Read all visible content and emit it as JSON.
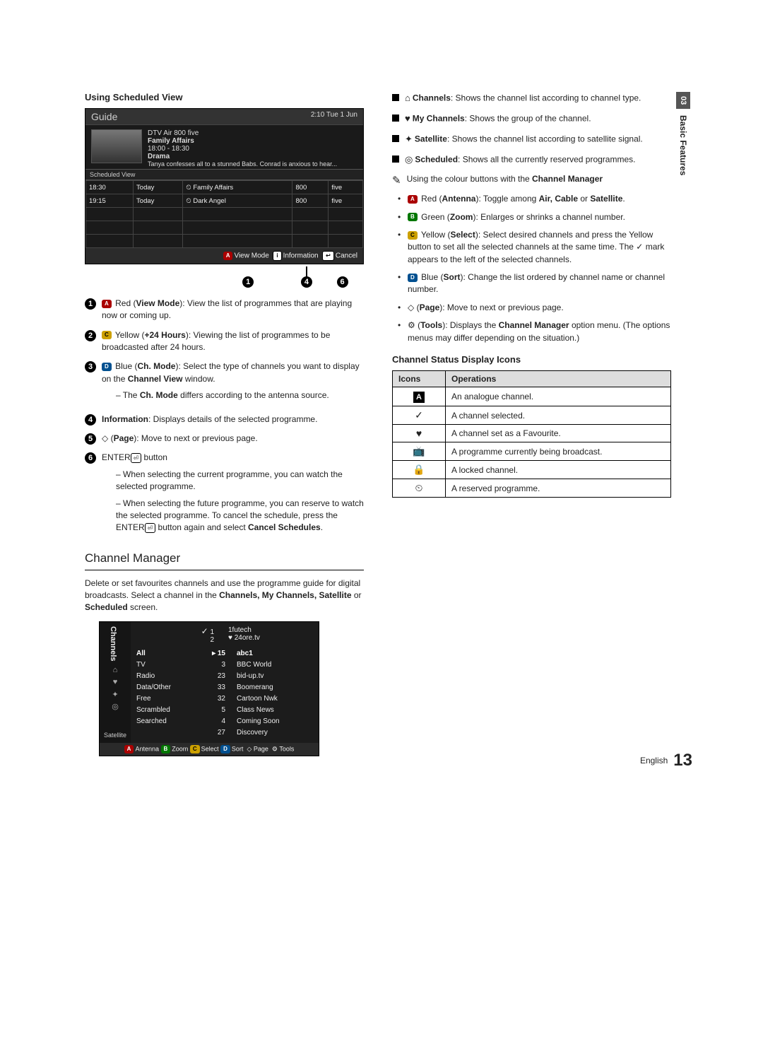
{
  "side": {
    "num": "03",
    "label": "Basic Features"
  },
  "left": {
    "heading": "Using Scheduled View",
    "guide": {
      "title": "Guide",
      "clock": "2:10 Tue 1 Jun",
      "info": {
        "source": "DTV Air 800 five",
        "prog": "Family Affairs",
        "time": "18:00 - 18:30",
        "genre": "Drama",
        "desc": "Tanya confesses all to a stunned Babs. Conrad is anxious to hear..."
      },
      "tab": "Scheduled View",
      "rows": [
        {
          "t": "18:30",
          "d": "Today",
          "title": "Family Affairs",
          "ch": "800",
          "name": "five"
        },
        {
          "t": "19:15",
          "d": "Today",
          "title": "Dark Angel",
          "ch": "800",
          "name": "five"
        }
      ],
      "footer": {
        "a": "View Mode",
        "i": "Information",
        "ret": "Cancel"
      },
      "callouts": {
        "a": "1",
        "b": "4",
        "c": "6"
      }
    },
    "items": [
      {
        "n": "1",
        "pre": "Red (",
        "bold": "View Mode",
        "post": "): View the list of programmes that are playing now or coming up.",
        "chip": "A"
      },
      {
        "n": "2",
        "pre": "Yellow (",
        "bold": "+24 Hours",
        "post": "): Viewing the list of programmes to be broadcasted after 24 hours.",
        "chip": "C"
      },
      {
        "n": "3",
        "pre": "Blue (",
        "bold": "Ch. Mode",
        "post": "): Select the type of channels you want to display on the ",
        "bold2": "Channel View",
        "post2": " window.",
        "chip": "D",
        "sub": [
          "The Ch. Mode differs according to the antenna source."
        ]
      },
      {
        "n": "4",
        "bold": "Information",
        "post": ": Displays details of the selected programme."
      },
      {
        "n": "5",
        "pre": "◇ (",
        "bold": "Page",
        "post": "): Move to next or previous page."
      },
      {
        "n": "6",
        "pre": "ENTER",
        "enter": true,
        "post": " button",
        "sub": [
          "When selecting the current programme, you can watch the selected programme.",
          "When selecting the future programme, you can reserve to watch the selected programme. To cancel the schedule, press the ENTER button again and select Cancel Schedules."
        ]
      }
    ],
    "cm_title": "Channel Manager",
    "cm_intro": "Delete or set favourites channels and use the programme guide for digital broadcasts. Select a channel in the ",
    "cm_intro_bold": "Channels, My Channels, Satellite",
    "cm_intro_post": " or ",
    "cm_intro_bold2": "Scheduled",
    "cm_intro_post2": " screen.",
    "cm_box": {
      "side_label": "Channels",
      "side_bottom": "Satellite",
      "pinned": [
        {
          "mark": "✓",
          "num": "1",
          "name": "1futech"
        },
        {
          "mark": "",
          "num": "2",
          "heart": true,
          "name": "24ore.tv"
        }
      ],
      "filters": [
        "All",
        "TV",
        "Radio",
        "Data/Other",
        "Free",
        "Scrambled",
        "Searched"
      ],
      "highlight": {
        "num": "15",
        "name": "abc1"
      },
      "rows": [
        {
          "num": "3",
          "name": "BBC World"
        },
        {
          "num": "23",
          "name": "bid-up.tv"
        },
        {
          "num": "33",
          "name": "Boomerang"
        },
        {
          "num": "32",
          "name": "Cartoon Nwk"
        },
        {
          "num": "5",
          "name": "Class News"
        },
        {
          "num": "4",
          "name": "Coming Soon"
        },
        {
          "num": "27",
          "name": "Discovery"
        }
      ],
      "footer": {
        "a": "Antenna",
        "b": "Zoom",
        "c": "Select",
        "d": "Sort",
        "page": "Page",
        "tools": "Tools"
      }
    }
  },
  "right": {
    "squares": [
      {
        "icon": "⌂",
        "bold": "Channels",
        "text": ": Shows the channel list according to channel type."
      },
      {
        "icon": "♥",
        "bold": "My Channels",
        "text": ": Shows the group of the channel."
      },
      {
        "icon": "✦",
        "bold": "Satellite",
        "text": ": Shows the channel list according to satellite signal."
      },
      {
        "icon": "◎",
        "bold": "Scheduled",
        "text": ": Shows all the currently reserved programmes."
      }
    ],
    "note_icon": "✎",
    "note": "Using the colour buttons with the ",
    "note_bold": "Channel Manager",
    "dots": [
      {
        "chip": "A",
        "pre": "Red (",
        "bold": "Antenna",
        "post": "): Toggle among ",
        "bold2": "Air, Cable",
        "post2": " or ",
        "bold3": "Satellite",
        "post3": "."
      },
      {
        "chip": "B",
        "pre": "Green (",
        "bold": "Zoom",
        "post": "): Enlarges or shrinks a channel number."
      },
      {
        "chip": "C",
        "pre": "Yellow (",
        "bold": "Select",
        "post": "): Select desired channels and press the Yellow button to set all the selected channels at the same time. The ✓ mark appears to the left of the selected channels."
      },
      {
        "chip": "D",
        "pre": "Blue (",
        "bold": "Sort",
        "post": "): Change the list ordered by channel name or channel number."
      },
      {
        "plain": "◇ (",
        "bold": "Page",
        "post": "): Move to next or previous page."
      },
      {
        "tools": true,
        "pre": " (",
        "bold": "Tools",
        "post": "): Displays the ",
        "bold2": "Channel Manager",
        "post2": " option menu. (The options menus may differ depending on the situation.)"
      }
    ],
    "table_heading": "Channel Status Display Icons",
    "table": {
      "h1": "Icons",
      "h2": "Operations",
      "rows": [
        {
          "icon": "A-badge",
          "op": "An analogue channel."
        },
        {
          "icon": "✓",
          "op": "A channel selected."
        },
        {
          "icon": "♥",
          "op": "A channel set as a Favourite."
        },
        {
          "icon": "⏧",
          "op": "A programme currently being broadcast."
        },
        {
          "icon": "🔒",
          "op": "A locked channel."
        },
        {
          "icon": "⏲",
          "op": "A reserved programme."
        }
      ]
    }
  },
  "footer": {
    "lang": "English",
    "page": "13"
  }
}
